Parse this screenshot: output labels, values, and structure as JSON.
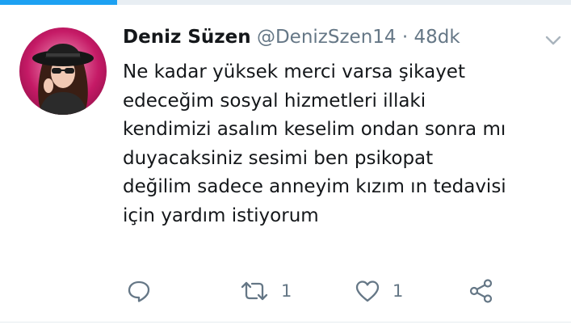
{
  "progress": {
    "fraction": 0.205,
    "color": "#1da1f2"
  },
  "tweet": {
    "display_name": "Deniz Süzen",
    "handle": "@DenizSzen14",
    "separator": "·",
    "time": "48dk",
    "text_lines": [
      "Ne kadar yüksek merci varsa şikayet",
      "edeceğim sosyal hizmetleri illaki",
      "kendimizi asalım keselim ondan sonra mı",
      "duyacaksiniz sesimi ben psikopat",
      "değilim sadece anneyim kızım ın tedavisi",
      "için yardım istiyorum"
    ]
  },
  "actions": {
    "reply_icon": "reply-icon",
    "retweet_icon": "retweet-icon",
    "retweet_count": "1",
    "like_icon": "heart-icon",
    "like_count": "1",
    "share_icon": "share-icon"
  },
  "colors": {
    "text": "#14171a",
    "secondary": "#657786",
    "accent": "#1da1f2",
    "divider": "#e6ecf0"
  }
}
